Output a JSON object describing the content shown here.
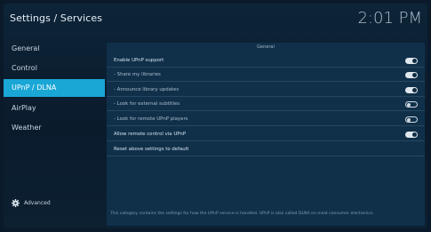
{
  "header": {
    "title": "Settings / Services",
    "clock": "2:01 PM"
  },
  "sidebar": {
    "items": [
      {
        "label": "General",
        "active": false
      },
      {
        "label": "Control",
        "active": false
      },
      {
        "label": "UPnP / DLNA",
        "active": true
      },
      {
        "label": "AirPlay",
        "active": false
      },
      {
        "label": "Weather",
        "active": false
      }
    ],
    "advanced_label": "Advanced",
    "advanced_icon": "gear-icon"
  },
  "panel": {
    "section_header": "General",
    "settings": [
      {
        "label": "Enable UPnP support",
        "state": "on"
      },
      {
        "label": "- Share my libraries",
        "state": "on"
      },
      {
        "label": "- Announce library updates",
        "state": "on"
      },
      {
        "label": "- Look for external subtitles",
        "state": "off"
      },
      {
        "label": "- Look for remote UPnP players",
        "state": "off"
      },
      {
        "label": "Allow remote control via UPnP",
        "state": "on"
      },
      {
        "label": "Reset above settings to default",
        "state": "none"
      }
    ]
  },
  "footer": {
    "help_text": "This category contains the settings for how the UPnP service is handled. UPnP is also called DLNA on most consumer electronics."
  },
  "colors": {
    "accent": "#1aa7d6",
    "background": "#0b1a2a",
    "panel": "#10304a"
  }
}
